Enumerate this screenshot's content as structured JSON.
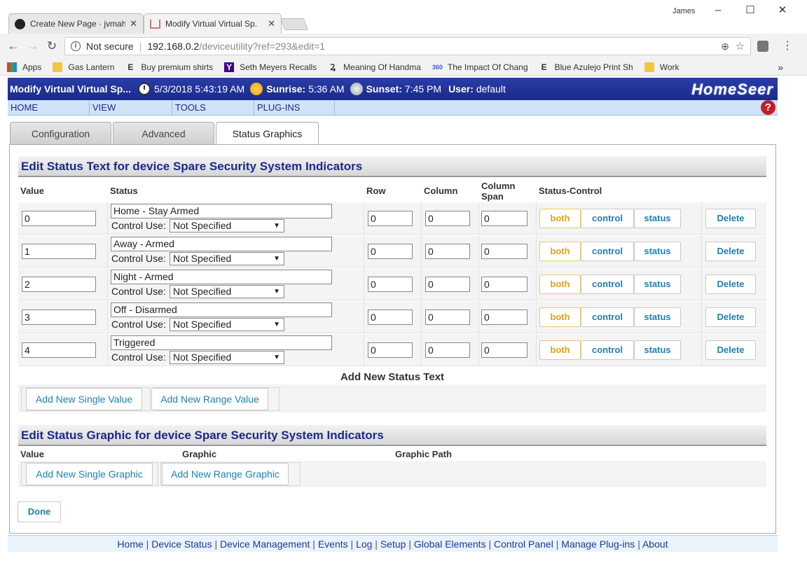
{
  "browser": {
    "tabs": [
      {
        "title": "Create New Page · jvmah",
        "icon": "github-icon"
      },
      {
        "title": "Modify Virtual Virtual Sp.",
        "icon": "homeseer-icon"
      }
    ],
    "user": "James",
    "window_controls": {
      "minimize": "–",
      "maximize": "☐",
      "close": "✕"
    },
    "address": {
      "security": "Not secure",
      "host": "192.168.0.2",
      "path": "/deviceutility?ref=293&edit=1"
    },
    "bookmarks": [
      {
        "label": "Apps",
        "icon": "apps-grid-icon"
      },
      {
        "label": "Gas Lantern",
        "icon": "folder-icon"
      },
      {
        "label": "Buy premium shirts",
        "icon": "etsy-icon"
      },
      {
        "label": "Seth Meyers Recalls",
        "icon": "yahoo-icon"
      },
      {
        "label": "Meaning Of Handma",
        "icon": "site-icon"
      },
      {
        "label": "The Impact Of Chang",
        "icon": "site-360-icon"
      },
      {
        "label": "Blue Azulejo Print Sh",
        "icon": "etsy-icon"
      },
      {
        "label": "Work",
        "icon": "folder-icon"
      }
    ],
    "bookmarks_more": "»"
  },
  "header": {
    "title": "Modify Virtual Virtual Sp...",
    "datetime": "5/3/2018 5:43:19 AM",
    "sunrise_label": "Sunrise:",
    "sunrise": "5:36 AM",
    "sunset_label": "Sunset:",
    "sunset": "7:45 PM",
    "user_label": "User:",
    "user": "default",
    "logo": "HomeSeer"
  },
  "menu": [
    "HOME",
    "VIEW",
    "TOOLS",
    "PLUG-INS"
  ],
  "page_tabs": [
    "Configuration",
    "Advanced",
    "Status Graphics"
  ],
  "status_text": {
    "title": "Edit Status Text for device Spare Security System Indicators",
    "columns": {
      "value": "Value",
      "status": "Status",
      "row": "Row",
      "column": "Column",
      "span": "Column Span",
      "status_control": "Status-Control"
    },
    "control_use_label": "Control Use:",
    "rows": [
      {
        "value": "0",
        "status": "Home - Stay Armed",
        "control_use": "Not Specified",
        "row": "0",
        "column": "0",
        "span": "0"
      },
      {
        "value": "1",
        "status": "Away - Armed",
        "control_use": "Not Specified",
        "row": "0",
        "column": "0",
        "span": "0"
      },
      {
        "value": "2",
        "status": "Night - Armed",
        "control_use": "Not Specified",
        "row": "0",
        "column": "0",
        "span": "0"
      },
      {
        "value": "3",
        "status": "Off - Disarmed",
        "control_use": "Not Specified",
        "row": "0",
        "column": "0",
        "span": "0"
      },
      {
        "value": "4",
        "status": "Triggered",
        "control_use": "Not Specified",
        "row": "0",
        "column": "0",
        "span": "0"
      }
    ],
    "buttons": {
      "both": "both",
      "control": "control",
      "status": "status",
      "delete": "Delete"
    },
    "add_title": "Add New Status Text",
    "add_single": "Add New Single Value",
    "add_range": "Add New Range Value"
  },
  "status_graphic": {
    "title": "Edit Status Graphic for device Spare Security System Indicators",
    "columns": {
      "value": "Value",
      "graphic": "Graphic",
      "path": "Graphic Path"
    },
    "add_single": "Add New Single Graphic",
    "add_range": "Add New Range Graphic"
  },
  "done": "Done",
  "footer": [
    "Home",
    "Device Status",
    "Device Management",
    "Events",
    "Log",
    "Setup",
    "Global Elements",
    "Control Panel",
    "Manage Plug-ins",
    "About"
  ],
  "colors": {
    "header_blue": "#1a2a8c",
    "menu_bg": "#cfe3f7",
    "link_blue": "#1f7fb3",
    "both_orange": "#e3a21a"
  }
}
